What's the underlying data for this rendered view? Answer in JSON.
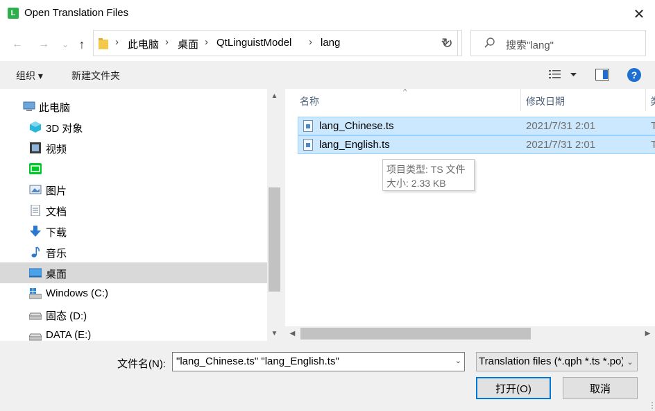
{
  "window": {
    "title": "Open Translation Files",
    "app_icon_letter": "L",
    "close_glyph": "✕"
  },
  "navbar": {
    "back_glyph": "←",
    "forward_glyph": "→",
    "recent_glyph": "⌄",
    "up_glyph": "↑",
    "breadcrumbs": [
      "此电脑",
      "桌面",
      "QtLinguistModel",
      "lang"
    ],
    "separator": "›",
    "refresh_glyph": "↻",
    "search_placeholder": "搜索\"lang\""
  },
  "toolbar": {
    "organize": "组织 ▾",
    "new_folder": "新建文件夹",
    "help": "?"
  },
  "sidebar": {
    "items": [
      {
        "label": "此电脑",
        "icon": "computer-icon",
        "level": 0
      },
      {
        "label": "3D 对象",
        "icon": "3d-objects-icon",
        "level": 1
      },
      {
        "label": "视频",
        "icon": "video-icon",
        "level": 1
      },
      {
        "label": "",
        "icon": "iqiyi-icon",
        "level": 1
      },
      {
        "label": "图片",
        "icon": "pictures-icon",
        "level": 1
      },
      {
        "label": "文档",
        "icon": "documents-icon",
        "level": 1
      },
      {
        "label": "下载",
        "icon": "downloads-icon",
        "level": 1
      },
      {
        "label": "音乐",
        "icon": "music-icon",
        "level": 1
      },
      {
        "label": "桌面",
        "icon": "desktop-icon",
        "level": 1,
        "selected": true
      },
      {
        "label": "Windows (C:)",
        "icon": "windows-drive-icon",
        "level": 1
      },
      {
        "label": "固态 (D:)",
        "icon": "drive-icon",
        "level": 1
      },
      {
        "label": "DATA (E:)",
        "icon": "drive-icon",
        "level": 1
      }
    ]
  },
  "files": {
    "columns": {
      "name": "名称",
      "date": "修改日期",
      "type": "类"
    },
    "rows": [
      {
        "name": "lang_Chinese.ts",
        "date": "2021/7/31 2:01",
        "type": "T"
      },
      {
        "name": "lang_English.ts",
        "date": "2021/7/31 2:01",
        "type": "T"
      }
    ]
  },
  "tooltip": {
    "type_line": "项目类型: TS 文件",
    "size_line": "大小: 2.33 KB"
  },
  "bottom": {
    "filename_label": "文件名(N):",
    "filename_value": "\"lang_Chinese.ts\" \"lang_English.ts\"",
    "filter_value": "Translation files (*.qph *.ts *.po)",
    "open_label": "打开(O)",
    "cancel_label": "取消"
  },
  "colors": {
    "selection_bg": "#cce8ff",
    "selection_border": "#99d1ff",
    "accent": "#0078d7",
    "header_text": "#4c607a"
  }
}
